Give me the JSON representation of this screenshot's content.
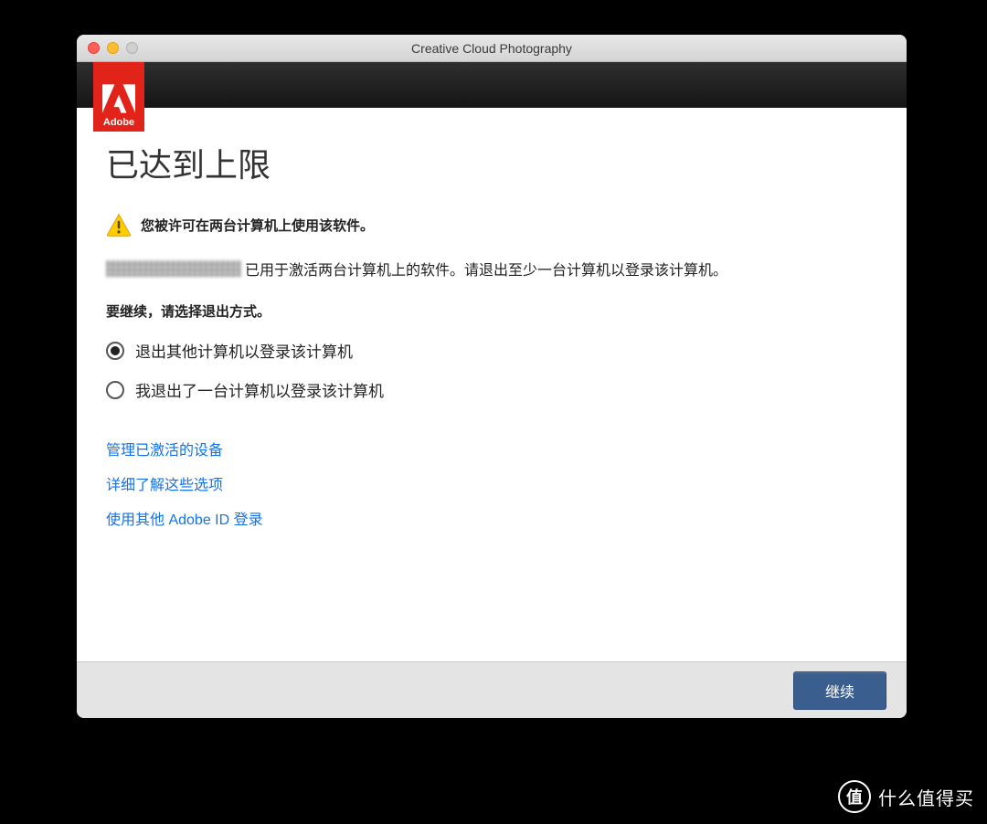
{
  "window": {
    "title": "Creative Cloud Photography"
  },
  "brand": {
    "name": "Adobe"
  },
  "content": {
    "heading": "已达到上限",
    "warning": "您被许可在两台计算机上使用该软件。",
    "info_suffix": "已用于激活两台计算机上的软件。请退出至少一台计算机以登录该计算机。",
    "prompt": "要继续，请选择退出方式。"
  },
  "options": {
    "opt1": "退出其他计算机以登录该计算机",
    "opt2": "我退出了一台计算机以登录该计算机",
    "selected": 0
  },
  "links": {
    "manage_devices": "管理已激活的设备",
    "learn_more": "详细了解这些选项",
    "other_id": "使用其他 Adobe ID 登录"
  },
  "footer": {
    "continue": "继续"
  },
  "watermark": {
    "badge": "值",
    "text": "什么值得买"
  }
}
